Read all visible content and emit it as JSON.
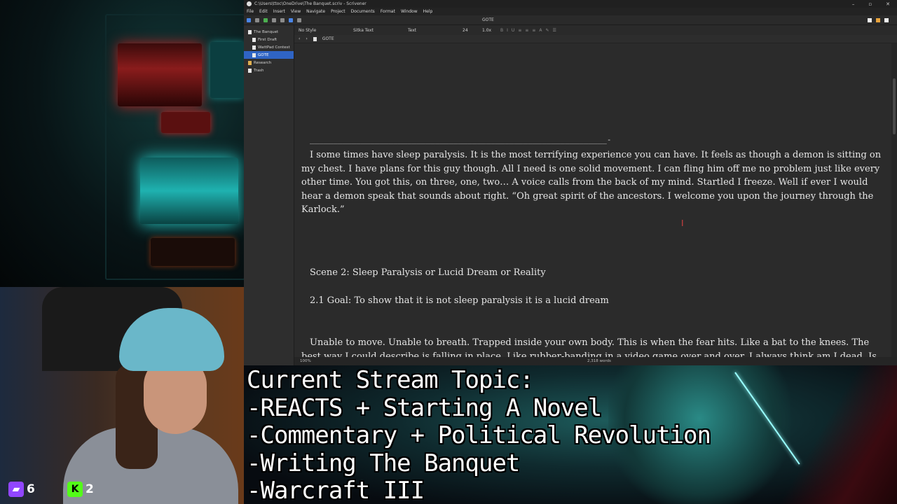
{
  "window": {
    "title": "C:\\Users\\ttoc\\OneDrive\\The Banquet.scriv - Scrivener",
    "controls": [
      "–",
      "▫",
      "✕"
    ]
  },
  "menu": [
    "File",
    "Edit",
    "Insert",
    "View",
    "Navigate",
    "Project",
    "Documents",
    "Format",
    "Window",
    "Help"
  ],
  "toolbar": {
    "center_title": "GOTE"
  },
  "binder": {
    "items": [
      {
        "label": "The Banquet"
      },
      {
        "label": "First Draft"
      },
      {
        "label": "WattPad Contest"
      },
      {
        "label": "GOTE"
      },
      {
        "label": "Research"
      },
      {
        "label": "Trash"
      }
    ]
  },
  "format_bar": {
    "style": "No Style",
    "font": "Sitka Text",
    "variant": "Text",
    "size": "24",
    "spacing": "1.0x"
  },
  "editor": {
    "header_title": "GOTE",
    "rule": "________________________________________________________________-",
    "para1": "I some times have sleep paralysis. It is the most terrifying experience you can have. It feels as though a demon is sitting on my chest. I have plans for this guy though. All I need is one solid movement. I can fling him off me no problem just like every other time. You got this, on three, one, two… A voice calls from the back of my mind. Startled I freeze. Well if ever I would hear a demon speak that sounds about right. “Oh great spirit of the ancestors. I welcome you upon the journey through the Karlock.”",
    "scene": "Scene 2: Sleep Paralysis or Lucid Dream or Reality",
    "goal": "2.1 Goal: To show that it is not sleep paralysis it is a lucid dream",
    "para2": "Unable to move. Unable to breath. Trapped inside your own body. This is when the fear hits. Like a bat to the knees. The best way I could describe is falling in place. Like rubber-banding in a video game over and over. I always think am I dead. Is this what its going to be like forever? I can’t be dead if I still feel things. The thoughts"
  },
  "status": {
    "zoom": "100%",
    "word_count": "2,318 words"
  },
  "overlay": {
    "lines": [
      "Current Stream Topic:",
      "-REACTS + Starting A Novel",
      "-Commentary + Political Revolution",
      "-Writing The Banquet",
      "-Warcraft III"
    ]
  },
  "social": {
    "twitch_count": "6",
    "kick_count": "2"
  },
  "colors": {
    "selection": "#2f64c4",
    "twitch": "#9146ff",
    "kick": "#53fc18"
  }
}
